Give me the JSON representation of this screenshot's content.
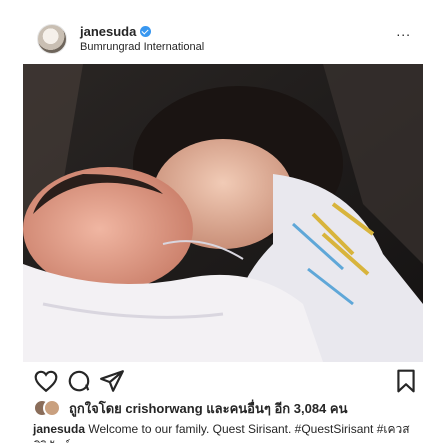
{
  "post": {
    "username": "janesuda",
    "location": "Bumrungrad International",
    "more_label": "...",
    "verified": true,
    "image_description_icon": "photo"
  },
  "actions": {
    "like_icon": "heart-icon",
    "comment_icon": "comment-icon",
    "share_icon": "send-icon",
    "save_icon": "bookmark-icon"
  },
  "likes": {
    "text": "ถูกใจโดย crishorwang และคนอื่นๆ อีก 3,084 คน"
  },
  "caption": {
    "username": "janesuda",
    "text": "Welcome to our family. Quest Sirisant. #QuestSirisant #เควสศิริสันต์"
  },
  "colors": {
    "verified_blue": "#3897f0",
    "text": "#262626"
  }
}
